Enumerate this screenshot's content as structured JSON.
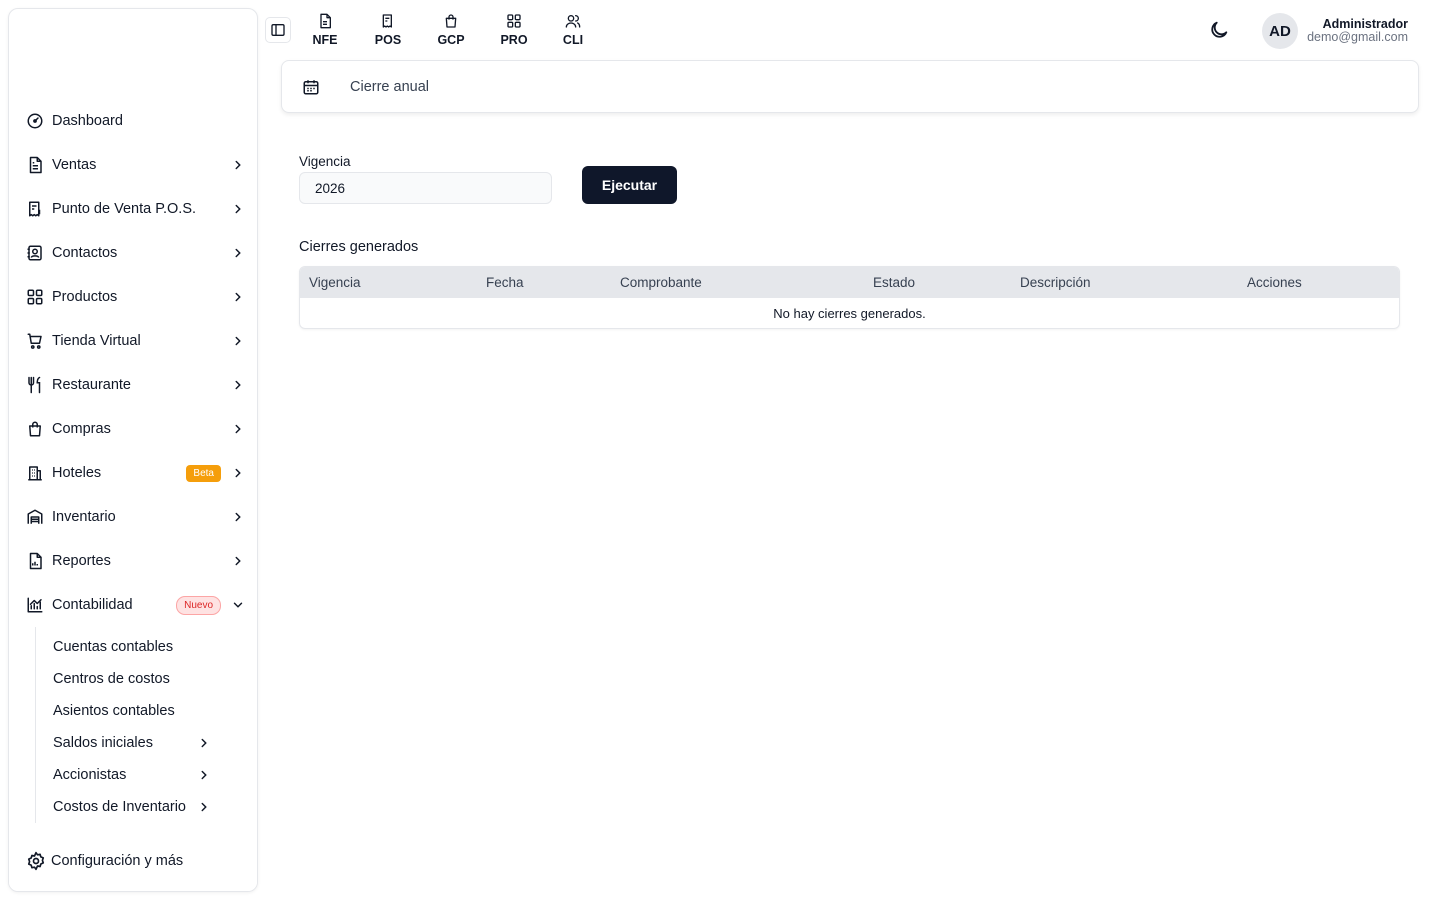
{
  "sidebar": {
    "items": [
      {
        "label": "Dashboard",
        "icon": "dashboard-icon"
      },
      {
        "label": "Ventas",
        "icon": "document-icon"
      },
      {
        "label": "Punto de Venta P.O.S.",
        "icon": "receipt-icon"
      },
      {
        "label": "Contactos",
        "icon": "contacts-icon"
      },
      {
        "label": "Productos",
        "icon": "grid-icon"
      },
      {
        "label": "Tienda Virtual",
        "icon": "cart-icon"
      },
      {
        "label": "Restaurante",
        "icon": "utensils-icon"
      },
      {
        "label": "Compras",
        "icon": "bag-icon"
      },
      {
        "label": "Hoteles",
        "icon": "building-icon",
        "badge": "Beta"
      },
      {
        "label": "Inventario",
        "icon": "warehouse-icon"
      },
      {
        "label": "Reportes",
        "icon": "report-icon"
      },
      {
        "label": "Contabilidad",
        "icon": "chart-icon",
        "badge": "Nuevo"
      }
    ],
    "sub_items": [
      {
        "label": "Cuentas contables"
      },
      {
        "label": "Centros de costos"
      },
      {
        "label": "Asientos contables"
      },
      {
        "label": "Saldos iniciales"
      },
      {
        "label": "Accionistas"
      },
      {
        "label": "Costos de Inventario"
      }
    ],
    "settings_label": "Configuración y más"
  },
  "topbar": {
    "apps": [
      {
        "label": "NFE",
        "icon": "file-icon"
      },
      {
        "label": "POS",
        "icon": "receipt-icon"
      },
      {
        "label": "GCP",
        "icon": "bag-icon"
      },
      {
        "label": "PRO",
        "icon": "grid-icon"
      },
      {
        "label": "CLI",
        "icon": "users-icon"
      }
    ],
    "user": {
      "initials": "AD",
      "name": "Administrador",
      "email": "demo@gmail.com"
    }
  },
  "header": {
    "title": "Cierre anual"
  },
  "form": {
    "vigencia_label": "Vigencia",
    "vigencia_value": "2026",
    "run_label": "Ejecutar"
  },
  "table": {
    "section_title": "Cierres generados",
    "columns": [
      "Vigencia",
      "Fecha",
      "Comprobante",
      "Estado",
      "Descripción",
      "Acciones"
    ],
    "empty_text": "No hay cierres generados."
  }
}
